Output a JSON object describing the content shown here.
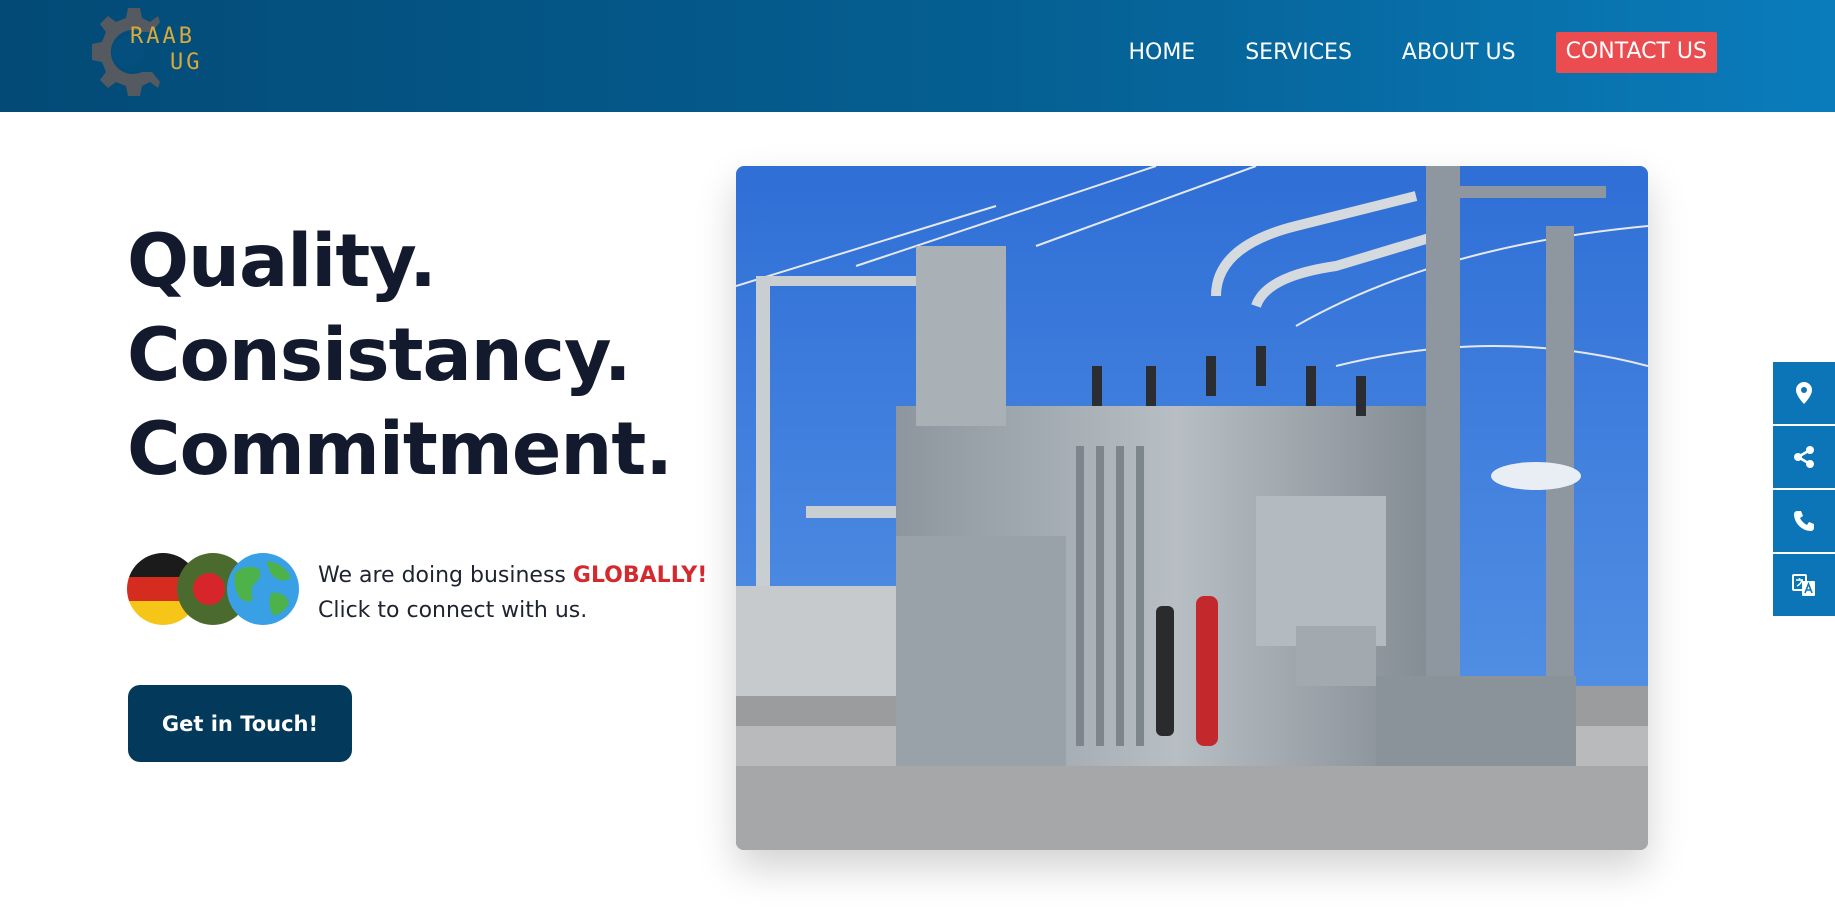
{
  "header": {
    "logo": {
      "line1": "RAAB",
      "line2": "UG",
      "icon": "gear-logo-icon"
    },
    "nav": [
      {
        "label": "HOME"
      },
      {
        "label": "SERVICES"
      },
      {
        "label": "ABOUT US"
      },
      {
        "label": "CONTACT US"
      }
    ],
    "contact_color": "#ea4c4f"
  },
  "hero": {
    "headline": [
      "Quality.",
      "Consistancy.",
      "Commitment."
    ],
    "global_text_prefix": "We are doing business ",
    "global_text_highlight": "GLOBALLY!",
    "global_text_line2": "Click to connect with us.",
    "flags": [
      "germany-flag-icon",
      "bangladesh-flag-icon",
      "globe-icon"
    ],
    "cta_label": "Get in Touch!",
    "image": "electrical-substation-transformer-photo"
  },
  "sidebar": {
    "icons": [
      "location-pin-icon",
      "share-icon",
      "phone-icon",
      "translate-icon"
    ]
  },
  "colors": {
    "header_start": "#034a76",
    "header_end": "#0a7cbb",
    "cta_bg": "#033a5c",
    "highlight": "#d42a2d",
    "sidebar_bg": "#0b75b8"
  }
}
